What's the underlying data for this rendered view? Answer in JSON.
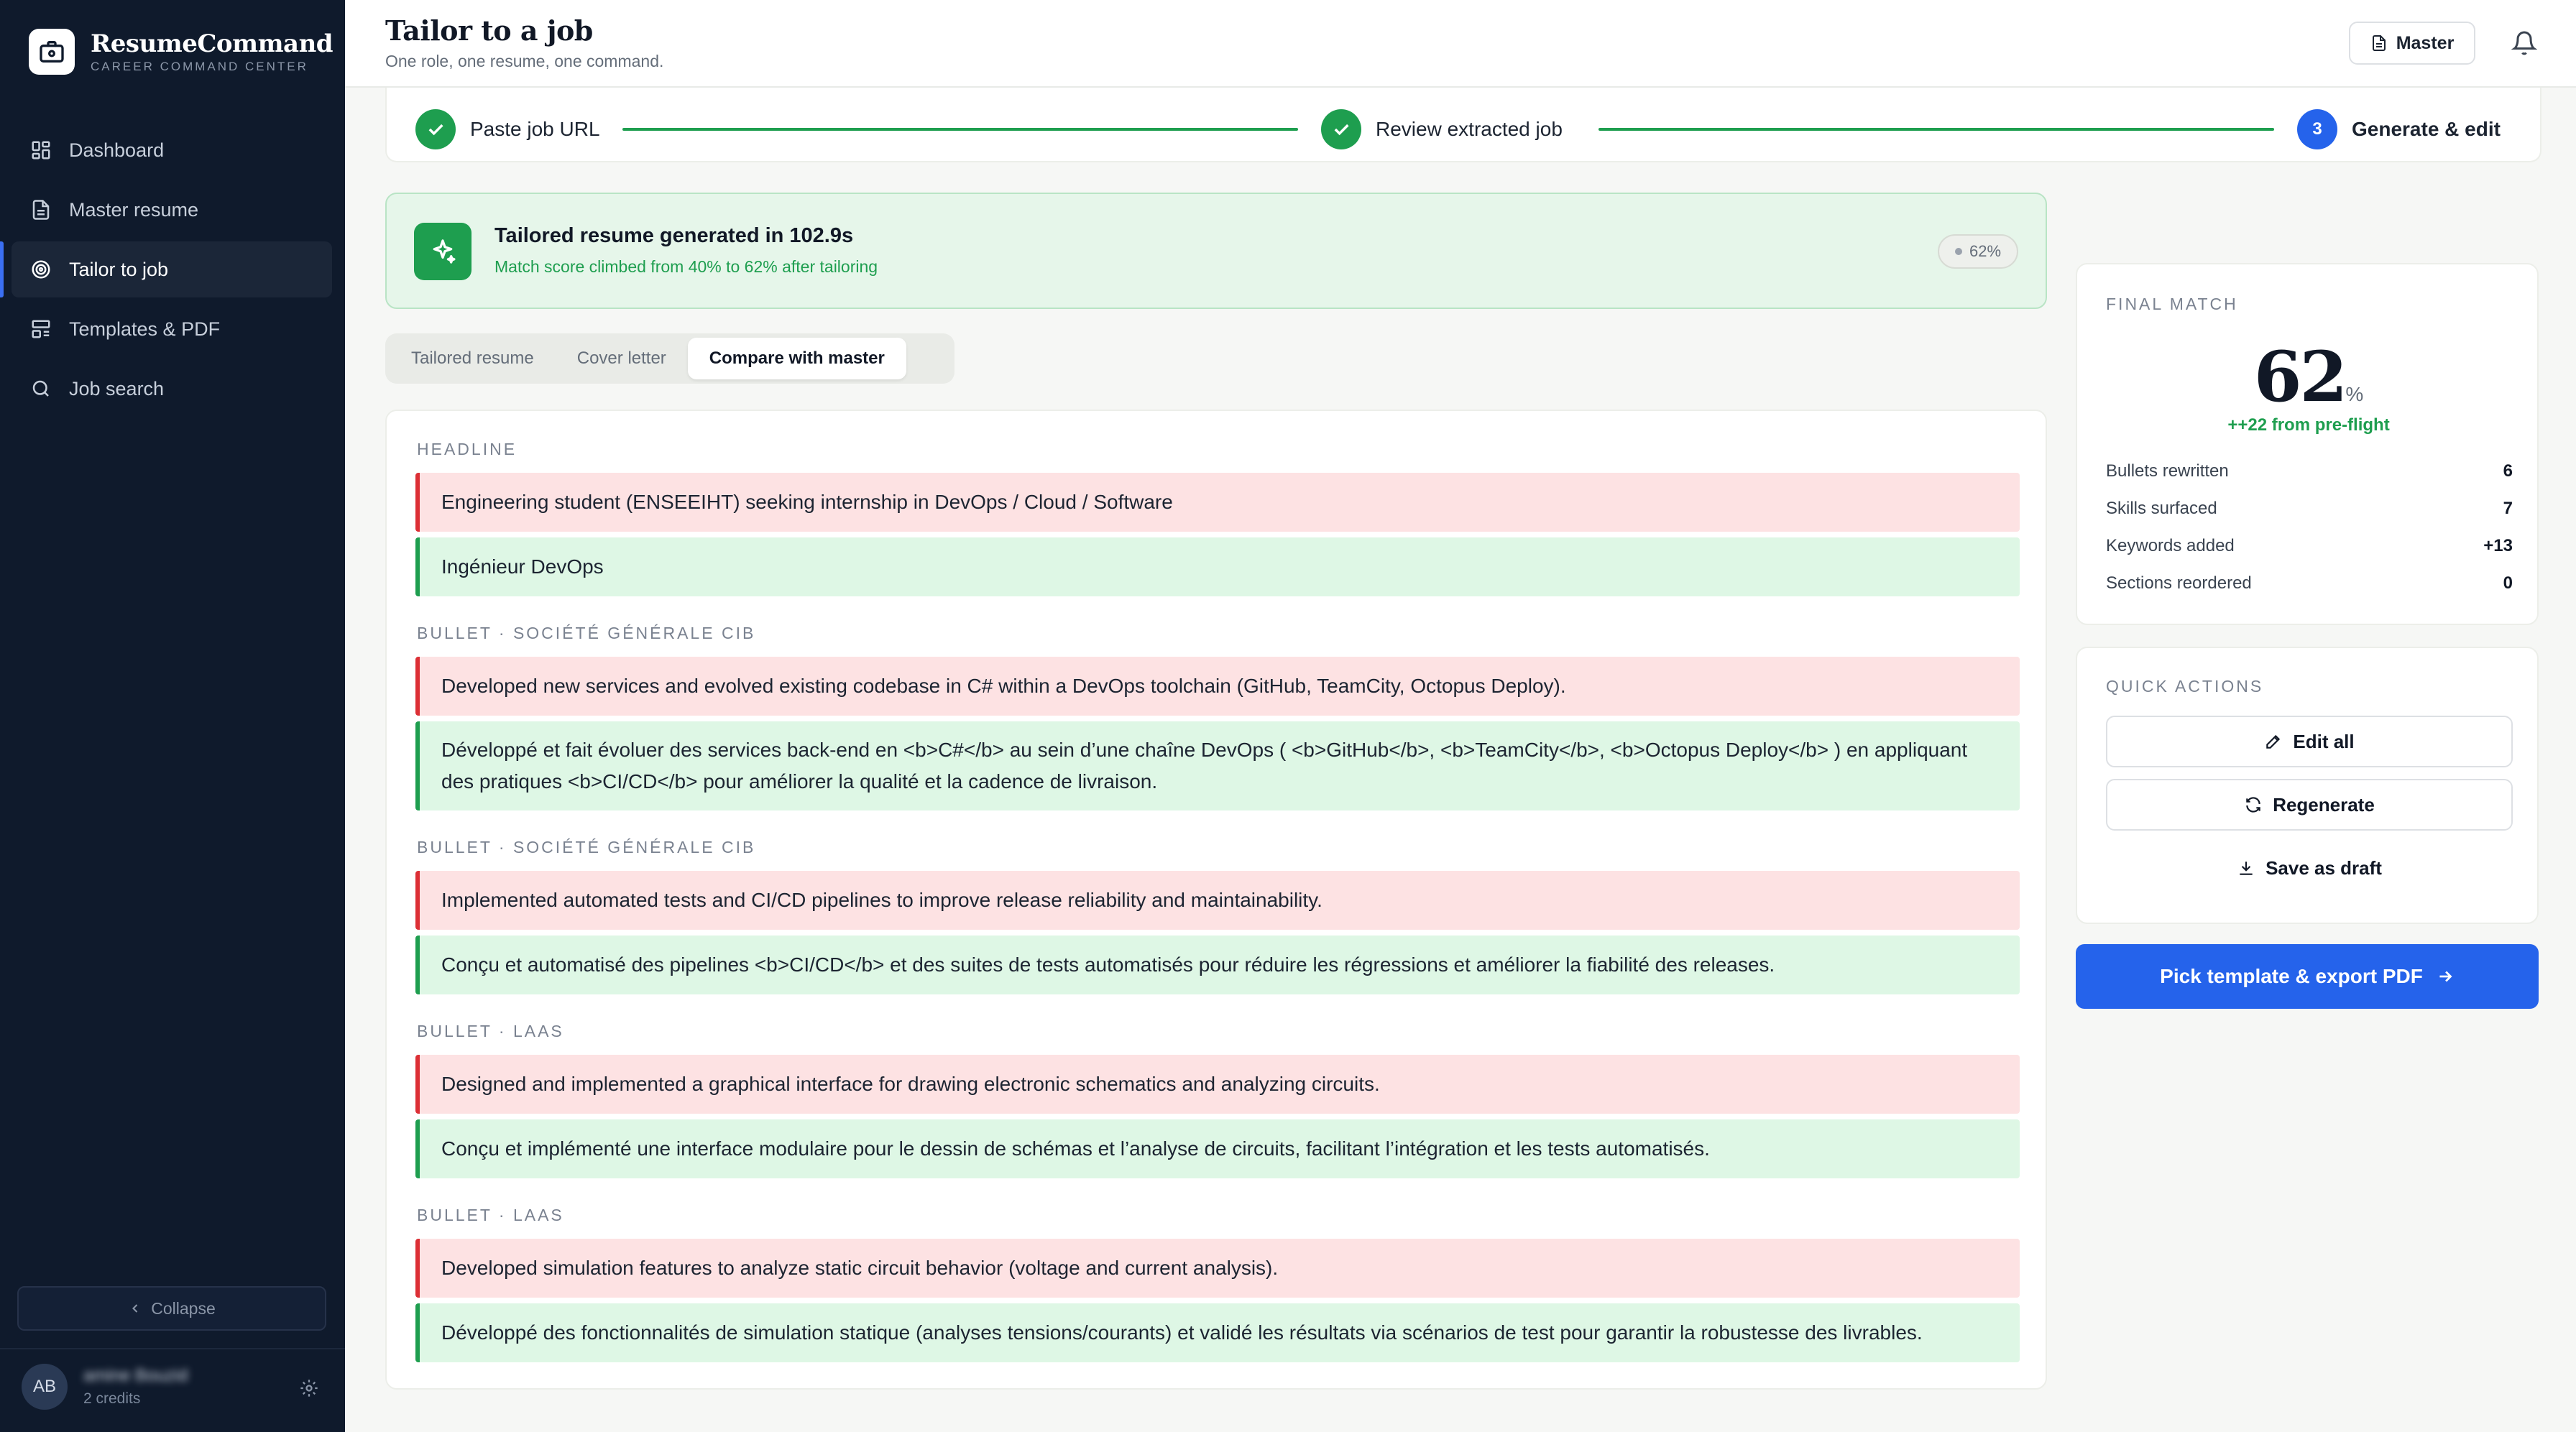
{
  "brand": {
    "name": "ResumeCommand",
    "tagline": "CAREER COMMAND CENTER"
  },
  "sidebar": {
    "items": [
      {
        "label": "Dashboard",
        "icon": "grid-icon"
      },
      {
        "label": "Master resume",
        "icon": "document-icon"
      },
      {
        "label": "Tailor to job",
        "icon": "target-icon",
        "active": true
      },
      {
        "label": "Templates & PDF",
        "icon": "layout-icon"
      },
      {
        "label": "Job search",
        "icon": "search-icon"
      }
    ],
    "collapse_label": "Collapse",
    "user": {
      "initials": "AB",
      "name": "amine Bouzid",
      "credits": "2 credits"
    }
  },
  "header": {
    "title": "Tailor to a job",
    "subtitle": "One role, one resume, one command.",
    "master_label": "Master"
  },
  "stepper": {
    "steps": [
      {
        "label": "Paste job URL",
        "state": "done"
      },
      {
        "label": "Review extracted job",
        "state": "done"
      },
      {
        "label": "Generate & edit",
        "state": "current",
        "number": "3"
      }
    ]
  },
  "success": {
    "title": "Tailored resume generated in 102.9s",
    "subtitle": "Match score climbed from 40% to 62% after tailoring",
    "badge": "62%"
  },
  "tabs": [
    {
      "label": "Tailored resume"
    },
    {
      "label": "Cover letter"
    },
    {
      "label": "Compare with master",
      "active": true
    }
  ],
  "diff": {
    "sections": [
      {
        "label": "HEADLINE",
        "old": "Engineering student (ENSEEIHT) seeking internship in DevOps / Cloud / Software",
        "new": "Ingénieur DevOps"
      },
      {
        "label": "BULLET · SOCIÉTÉ GÉNÉRALE CIB",
        "old": "Developed new services and evolved existing codebase in C# within a DevOps toolchain (GitHub, TeamCity, Octopus Deploy).",
        "new": "Développé et fait évoluer des services back-end en <b>C#</b> au sein d’une chaîne DevOps ( <b>GitHub</b>, <b>TeamCity</b>, <b>Octopus Deploy</b> ) en appliquant des pratiques <b>CI/CD</b> pour améliorer la qualité et la cadence de livraison."
      },
      {
        "label": "BULLET · SOCIÉTÉ GÉNÉRALE CIB",
        "old": "Implemented automated tests and CI/CD pipelines to improve release reliability and maintainability.",
        "new": "Conçu et automatisé des pipelines <b>CI/CD</b> et des suites de tests automatisés pour réduire les régressions et améliorer la fiabilité des releases."
      },
      {
        "label": "BULLET · LAAS",
        "old": "Designed and implemented a graphical interface for drawing electronic schematics and analyzing circuits.",
        "new": "Conçu et implémenté une interface modulaire pour le dessin de schémas et l’analyse de circuits, facilitant l’intégration et les tests automatisés."
      },
      {
        "label": "BULLET · LAAS",
        "old": "Developed simulation features to analyze static circuit behavior (voltage and current analysis).",
        "new": "Développé des fonctionnalités de simulation statique (analyses tensions/courants) et validé les résultats via scénarios de test pour garantir la robustesse des livrables."
      }
    ]
  },
  "final_match": {
    "label": "FINAL MATCH",
    "score": "62",
    "unit": "%",
    "delta": "++22 from pre-flight",
    "stats": [
      {
        "label": "Bullets rewritten",
        "value": "6"
      },
      {
        "label": "Skills surfaced",
        "value": "7"
      },
      {
        "label": "Keywords added",
        "value": "+13"
      },
      {
        "label": "Sections reordered",
        "value": "0"
      }
    ]
  },
  "quick_actions": {
    "label": "QUICK ACTIONS",
    "edit_all": "Edit all",
    "regenerate": "Regenerate",
    "save_draft": "Save as draft"
  },
  "export": {
    "label": "Pick template & export PDF"
  },
  "colors": {
    "sidebar_bg": "#0f1a2c",
    "accent": "#2563eb",
    "success": "#1e9e4f",
    "removed_bg": "#fde2e3",
    "added_bg": "#def7e5"
  }
}
